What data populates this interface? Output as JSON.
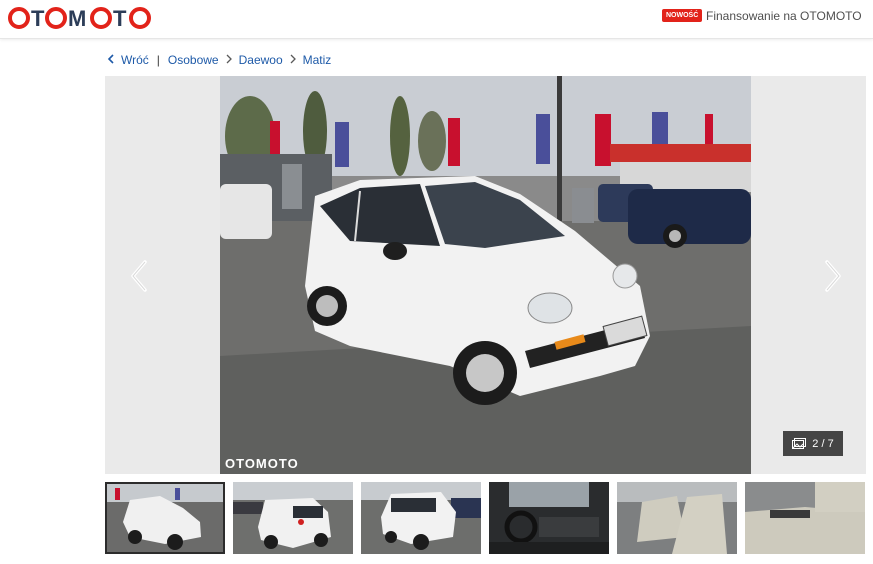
{
  "header": {
    "logo_text": "OTOMOTO",
    "badge": "NOWOŚĆ",
    "financing_link": "Finansowanie na OTOMOTO"
  },
  "breadcrumb": {
    "back": "Wróć",
    "items": [
      "Osobowe",
      "Daewoo",
      "Matiz"
    ]
  },
  "gallery": {
    "counter": "2 / 7",
    "watermark": "OTOMOTO"
  },
  "colors": {
    "brand_red": "#e2231a",
    "brand_navy": "#2c3d58",
    "link_blue": "#1e5aa8"
  }
}
